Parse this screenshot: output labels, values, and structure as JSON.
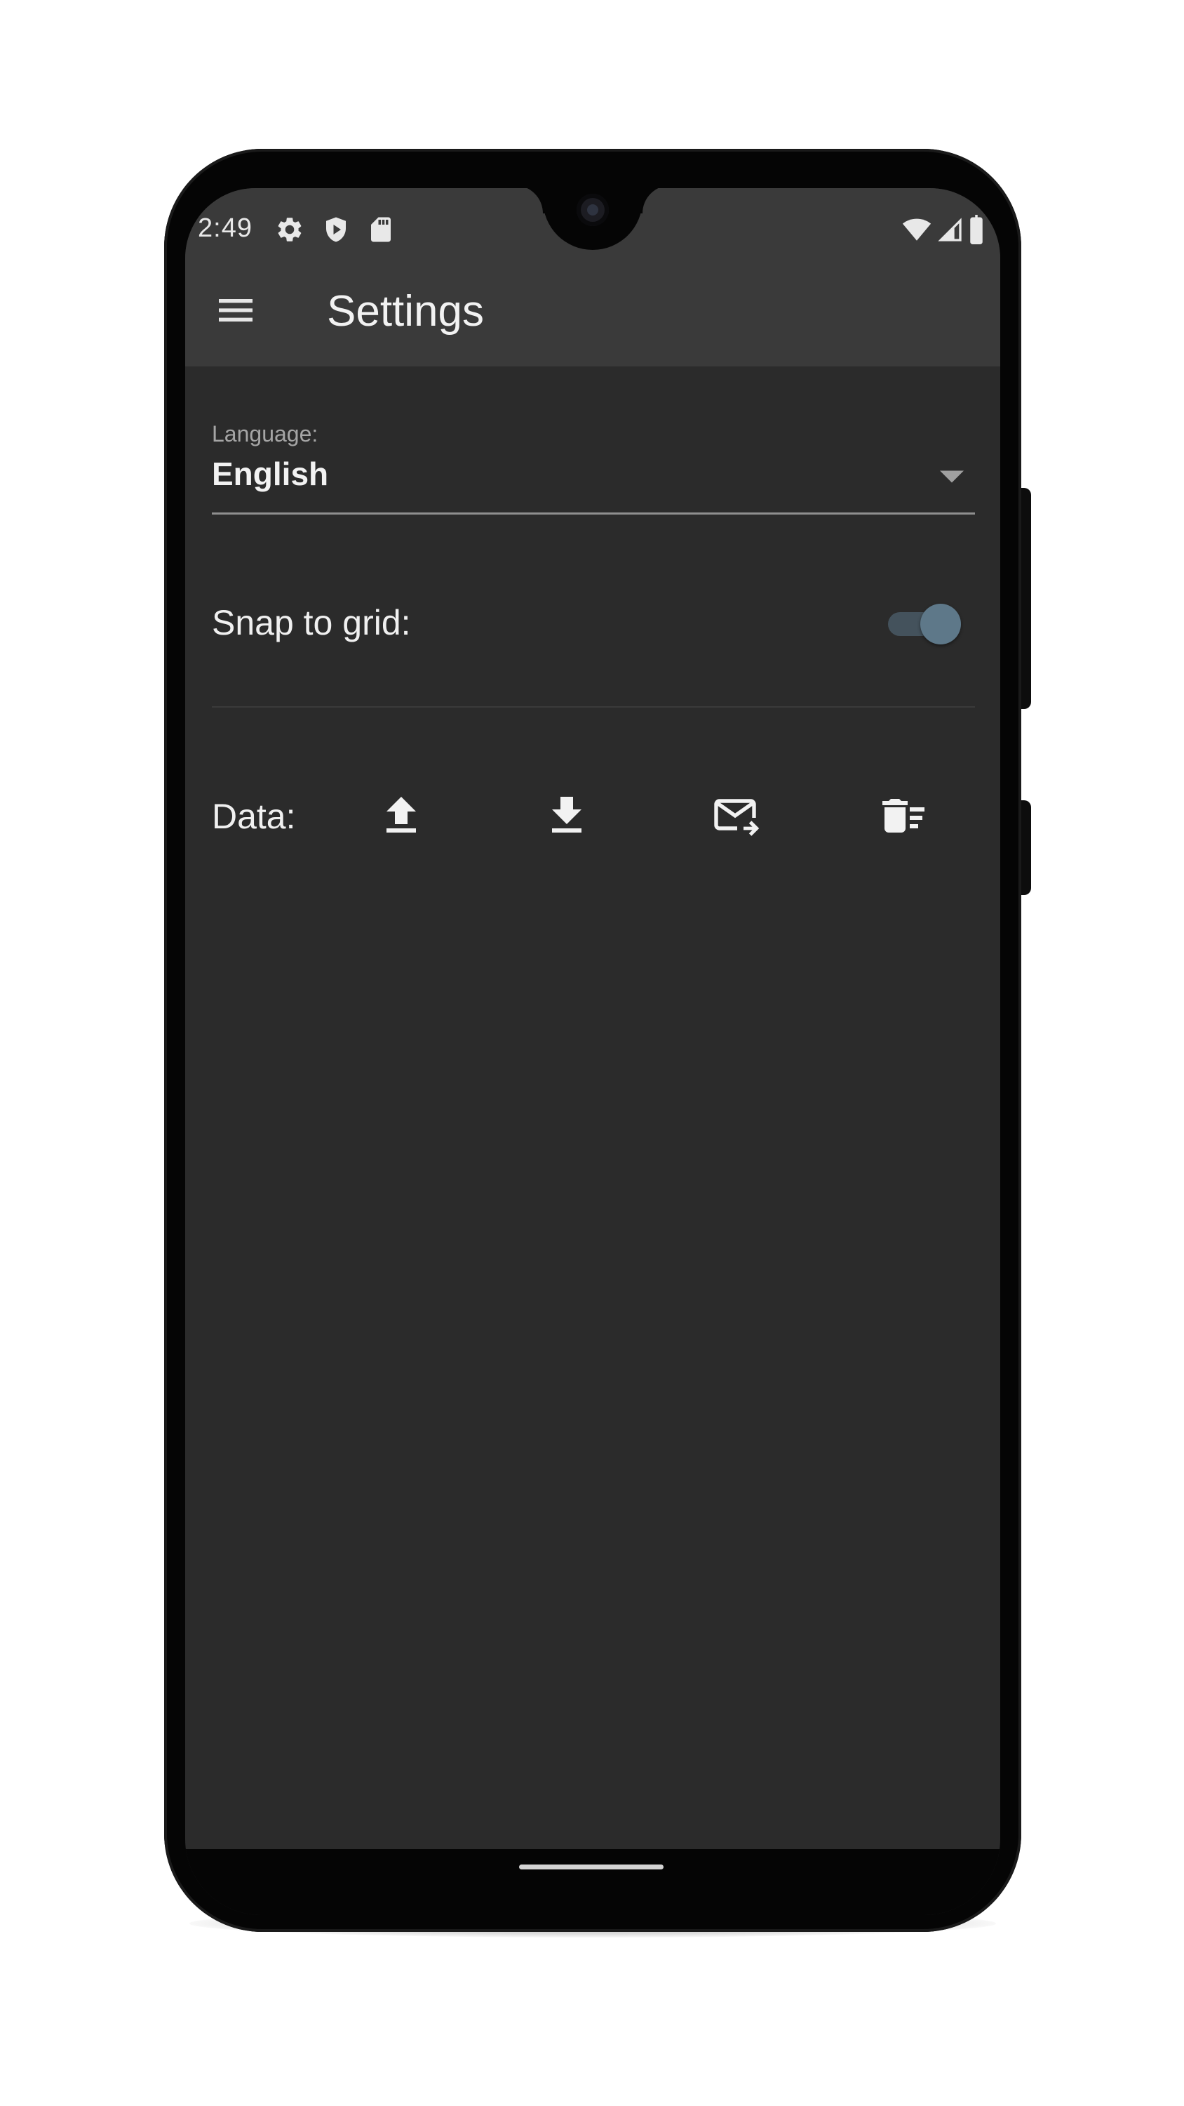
{
  "status_bar": {
    "time": "2:49",
    "left_icons": [
      "gear-icon",
      "play-protect-icon",
      "sd-card-icon"
    ],
    "right_icons": [
      "wifi-icon",
      "cell-signal-icon",
      "battery-icon"
    ]
  },
  "app_bar": {
    "menu_icon": "hamburger-menu-icon",
    "title": "Settings",
    "background": "#3a3a3a"
  },
  "settings": {
    "language": {
      "label": "Language:",
      "value": "English"
    },
    "snap_to_grid": {
      "label": "Snap to grid:",
      "enabled": true,
      "thumb_color": "#5e7889",
      "track_color": "#44525c"
    },
    "data": {
      "label": "Data:",
      "actions": [
        "upload-icon",
        "download-icon",
        "email-export-icon",
        "delete-sweep-icon"
      ]
    }
  },
  "colors": {
    "screen_background": "#2b2b2b",
    "text_primary": "#f0f0f0",
    "text_secondary": "#a5a5a5"
  }
}
